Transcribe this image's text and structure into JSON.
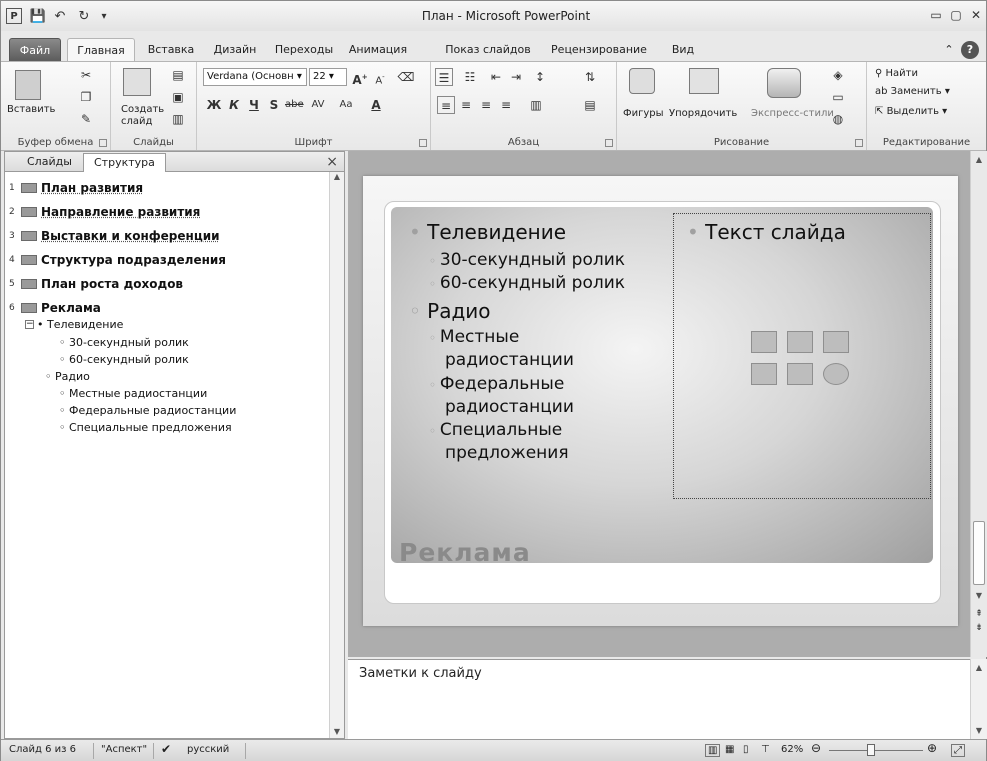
{
  "window": {
    "title": "План - Microsoft PowerPoint"
  },
  "qat": {
    "app_icon": "P",
    "save_icon": "save-icon",
    "undo_icon": "undo-icon",
    "redo_icon": "redo-icon"
  },
  "tabs": [
    {
      "label": "Файл"
    },
    {
      "label": "Главная"
    },
    {
      "label": "Вставка"
    },
    {
      "label": "Дизайн"
    },
    {
      "label": "Переходы"
    },
    {
      "label": "Анимация"
    },
    {
      "label": "Показ слайдов"
    },
    {
      "label": "Рецензирование"
    },
    {
      "label": "Вид"
    }
  ],
  "ribbon": {
    "clipboard": {
      "paste": "Вставить",
      "label": "Буфер обмена"
    },
    "slides": {
      "new_slide": "Создать",
      "new_slide2": "слайд",
      "label": "Слайды"
    },
    "font": {
      "family": "Verdana (Основн",
      "size": "22",
      "label": "Шрифт",
      "bold": "Ж",
      "italic": "К",
      "underline": "Ч",
      "shadow": "S",
      "strike": "abe",
      "case": "Aa",
      "color": "A"
    },
    "paragraph": {
      "label": "Абзац"
    },
    "drawing": {
      "shapes": "Фигуры",
      "arrange": "Упорядочить",
      "styles": "Экспресс-стили",
      "label": "Рисование"
    },
    "editing": {
      "find": "Найти",
      "replace": "Заменить",
      "select": "Выделить",
      "label": "Редактирование"
    }
  },
  "pane": {
    "tab_slides": "Слайды",
    "tab_outline": "Структура",
    "slides": [
      {
        "num": "1",
        "title": "План развития"
      },
      {
        "num": "2",
        "title": "Направление развития"
      },
      {
        "num": "3",
        "title": "Выставки и конференции"
      },
      {
        "num": "4",
        "title": "Структура подразделения"
      },
      {
        "num": "5",
        "title": "План роста доходов"
      },
      {
        "num": "6",
        "title": "Реклама"
      }
    ],
    "outline_items": [
      "• Телевидение",
      "◦ 30-секундный ролик",
      "◦ 60-секундный ролик",
      "◦ Радио",
      "◦ Местные радиостанции",
      "◦ Федеральные радиостанции",
      "◦ Специальные предложения"
    ]
  },
  "slide": {
    "title": "Реклама",
    "left": [
      "Телевидение",
      "30-секундный ролик",
      "60-секундный ролик",
      "Радио",
      "Местные",
      "радиостанции",
      "Федеральные",
      "радиостанции",
      "Специальные",
      "предложения"
    ],
    "placeholder": "Текст слайда"
  },
  "notes": {
    "placeholder": "Заметки к слайду"
  },
  "status": {
    "slide_info": "Слайд 6 из 6",
    "theme": "\"Аспект\"",
    "language": "русский",
    "zoom": "62%"
  }
}
